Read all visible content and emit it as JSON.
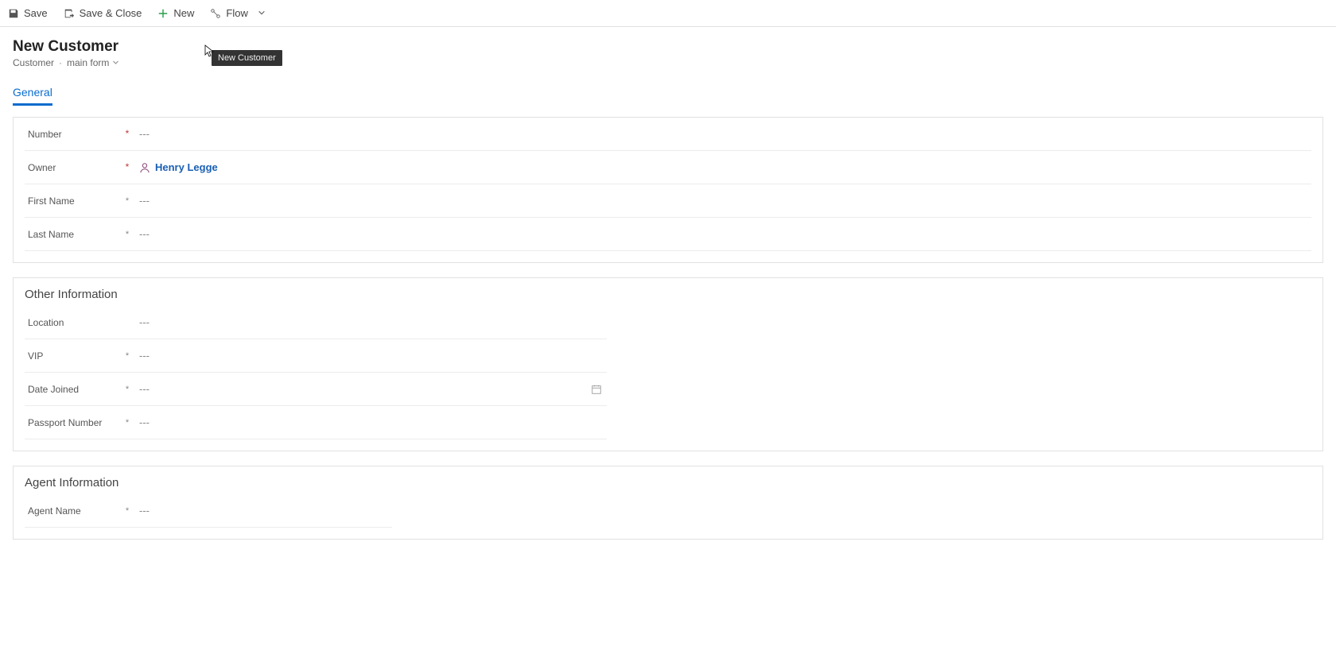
{
  "toolbar": {
    "save": "Save",
    "save_close": "Save & Close",
    "new": "New",
    "flow": "Flow"
  },
  "header": {
    "title": "New Customer",
    "entity": "Customer",
    "form_name": "main form",
    "tooltip": "New Customer"
  },
  "tabs": [
    {
      "label": "General",
      "active": true
    }
  ],
  "sections": {
    "main": {
      "fields": [
        {
          "key": "number",
          "label": "Number",
          "required": "required",
          "value": "---",
          "type": "text"
        },
        {
          "key": "owner",
          "label": "Owner",
          "required": "required",
          "owner": "Henry Legge",
          "type": "owner"
        },
        {
          "key": "first_name",
          "label": "First Name",
          "required": "plain",
          "value": "---",
          "type": "text"
        },
        {
          "key": "last_name",
          "label": "Last Name",
          "required": "plain",
          "value": "---",
          "type": "text"
        }
      ]
    },
    "other": {
      "title": "Other Information",
      "fields": [
        {
          "key": "location",
          "label": "Location",
          "required": "",
          "value": "---",
          "type": "text"
        },
        {
          "key": "vip",
          "label": "VIP",
          "required": "plain",
          "value": "---",
          "type": "text"
        },
        {
          "key": "date_joined",
          "label": "Date Joined",
          "required": "plain",
          "value": "---",
          "type": "date"
        },
        {
          "key": "passport_number",
          "label": "Passport Number",
          "required": "plain",
          "value": "---",
          "type": "text"
        }
      ]
    },
    "agent": {
      "title": "Agent Information",
      "fields": [
        {
          "key": "agent_name",
          "label": "Agent Name",
          "required": "plain",
          "value": "---",
          "type": "text"
        }
      ]
    }
  }
}
